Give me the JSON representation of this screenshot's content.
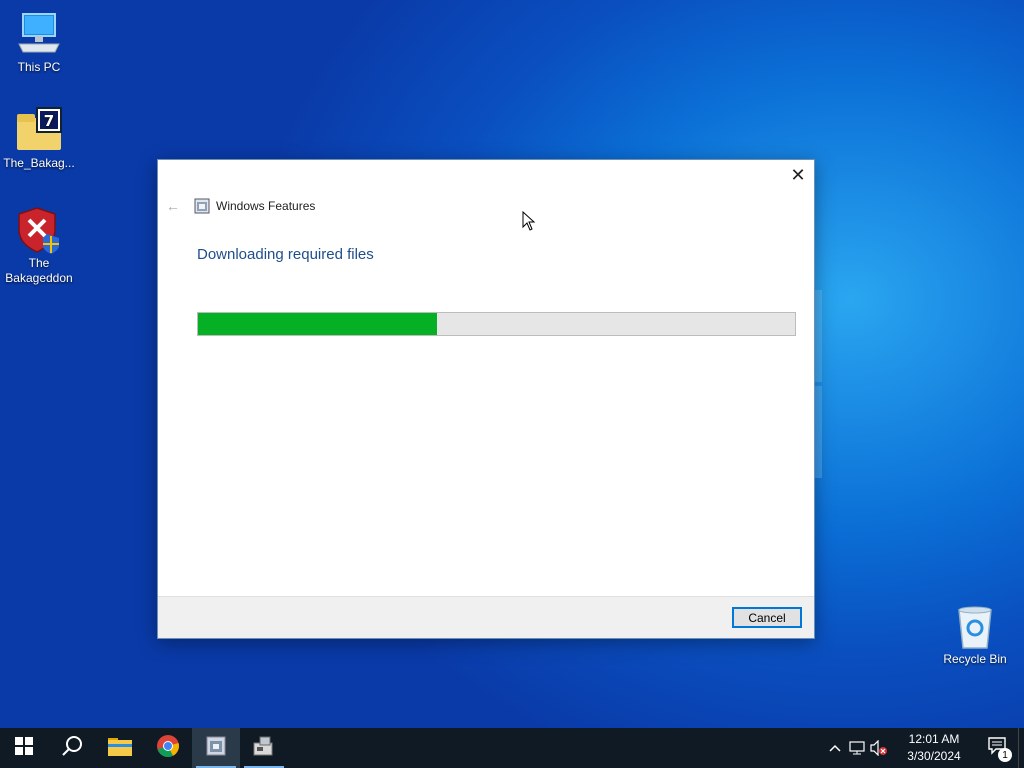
{
  "desktop": {
    "icons": [
      {
        "label": "This PC",
        "icon": "computer-icon"
      },
      {
        "label": "The_Bakag...",
        "icon": "7zip-archive-icon"
      },
      {
        "label": "The Bakageddon",
        "icon": "shield-error-icon"
      },
      {
        "label": "Recycle Bin",
        "icon": "recycle-bin-icon"
      }
    ]
  },
  "dialog": {
    "title": "Windows Features",
    "heading": "Downloading required files",
    "progress": 0.4,
    "cancel_label": "Cancel",
    "close_glyph": "✕",
    "back_glyph": "←"
  },
  "taskbar": {
    "items": [
      {
        "name": "start-button",
        "icon": "windows-logo-icon"
      },
      {
        "name": "search-button",
        "icon": "search-icon"
      },
      {
        "name": "file-explorer-button",
        "icon": "folder-icon"
      },
      {
        "name": "chrome-button",
        "icon": "chrome-icon"
      },
      {
        "name": "windows-features-button",
        "icon": "windows-features-icon"
      },
      {
        "name": "installer-button",
        "icon": "installer-icon"
      }
    ],
    "clock_time": "12:01 AM",
    "clock_date": "3/30/2024",
    "notification_count": "1"
  },
  "colors": {
    "progress_fill": "#06b025",
    "accent": "#0078d7",
    "heading": "#1f4e8c"
  }
}
